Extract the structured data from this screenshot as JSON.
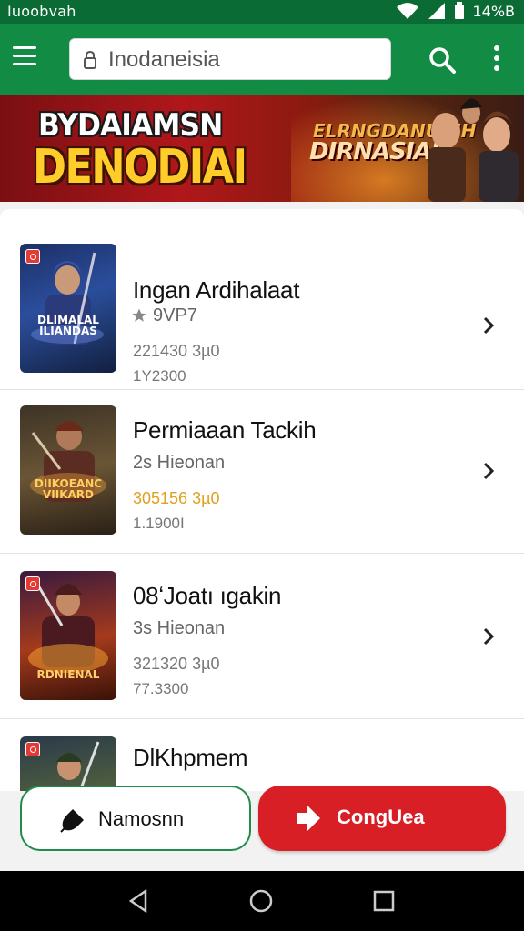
{
  "status_bar": {
    "left_text": "Iuoobvah",
    "right_text": "14%B"
  },
  "app_bar": {
    "search_value": "Inodaneisia"
  },
  "banner": {
    "title_line1": "BYDAIAMSN",
    "title_line2": "DENODIAI",
    "side_line1": "ELRNGDANUBIH",
    "side_line2": "DIRNASIAI"
  },
  "games": [
    {
      "title": "Ingan Ardihalaat",
      "sub": "9VP7",
      "meta": "221430 3µ0",
      "meta2": "1Y2300",
      "logo": "DLIMALAL ILIANDAS",
      "has_star": true,
      "meta_accent": false
    },
    {
      "title": "Permiaaan Tackih",
      "sub": "2s Hieonan",
      "meta": "305156 3µ0",
      "meta2": "1.1900I",
      "logo": "DIIKOEANC VIIKARD",
      "has_star": false,
      "meta_accent": true
    },
    {
      "title": "08ʻJoatı ıgakin",
      "sub": "3s Hieonan",
      "meta": "321320 3µ0",
      "meta2": "77.3300",
      "logo": "RDNIENAL",
      "has_star": false,
      "meta_accent": false
    },
    {
      "title": "DlKhpmem",
      "sub": "",
      "meta": "",
      "meta2": "",
      "logo": "",
      "has_star": false,
      "meta_accent": false
    }
  ],
  "buttons": {
    "left_label": "Namosnn",
    "right_label": "CongUea"
  },
  "colors": {
    "primary_green": "#128c44",
    "accent_red": "#d81f26"
  },
  "icons": [
    "menu-icon",
    "lock-icon",
    "search-icon",
    "more-vert-icon",
    "star-icon",
    "chevron-right-icon",
    "pen-icon",
    "arrow-right-icon",
    "back-icon",
    "home-icon",
    "recents-icon"
  ]
}
